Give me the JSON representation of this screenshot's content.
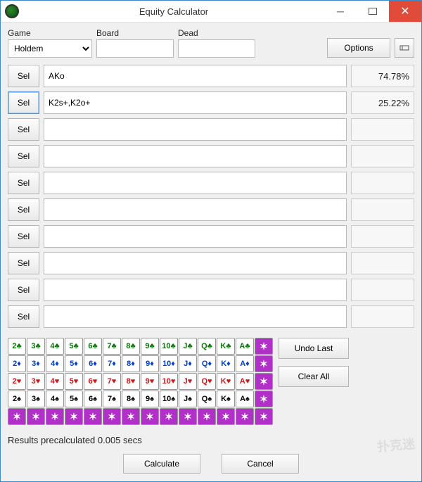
{
  "window": {
    "title": "Equity Calculator"
  },
  "labels": {
    "game": "Game",
    "board": "Board",
    "dead": "Dead"
  },
  "game": {
    "selected": "Holdem"
  },
  "board": {
    "value": ""
  },
  "dead": {
    "value": ""
  },
  "buttons": {
    "options": "Options",
    "sel": "Sel",
    "undo_last": "Undo Last",
    "clear_all": "Clear All",
    "calculate": "Calculate",
    "cancel": "Cancel"
  },
  "hands": [
    {
      "range": "AKo",
      "equity": "74.78%",
      "selected": false
    },
    {
      "range": "K2s+,K2o+",
      "equity": "25.22%",
      "selected": true
    },
    {
      "range": "",
      "equity": "",
      "selected": false
    },
    {
      "range": "",
      "equity": "",
      "selected": false
    },
    {
      "range": "",
      "equity": "",
      "selected": false
    },
    {
      "range": "",
      "equity": "",
      "selected": false
    },
    {
      "range": "",
      "equity": "",
      "selected": false
    },
    {
      "range": "",
      "equity": "",
      "selected": false
    },
    {
      "range": "",
      "equity": "",
      "selected": false
    },
    {
      "range": "",
      "equity": "",
      "selected": false
    }
  ],
  "cards": {
    "ranks": [
      "2",
      "3",
      "4",
      "5",
      "6",
      "7",
      "8",
      "9",
      "10",
      "J",
      "Q",
      "K",
      "A"
    ],
    "suits": [
      {
        "name": "club",
        "symbol": "♣",
        "class": "club"
      },
      {
        "name": "diamond",
        "symbol": "♦",
        "class": "diamond"
      },
      {
        "name": "heart",
        "symbol": "♥",
        "class": "heart"
      },
      {
        "name": "spade",
        "symbol": "♠",
        "class": "spade"
      }
    ],
    "wild": "✶"
  },
  "status": "Results precalculated 0.005 secs",
  "watermark": "扑克迷"
}
